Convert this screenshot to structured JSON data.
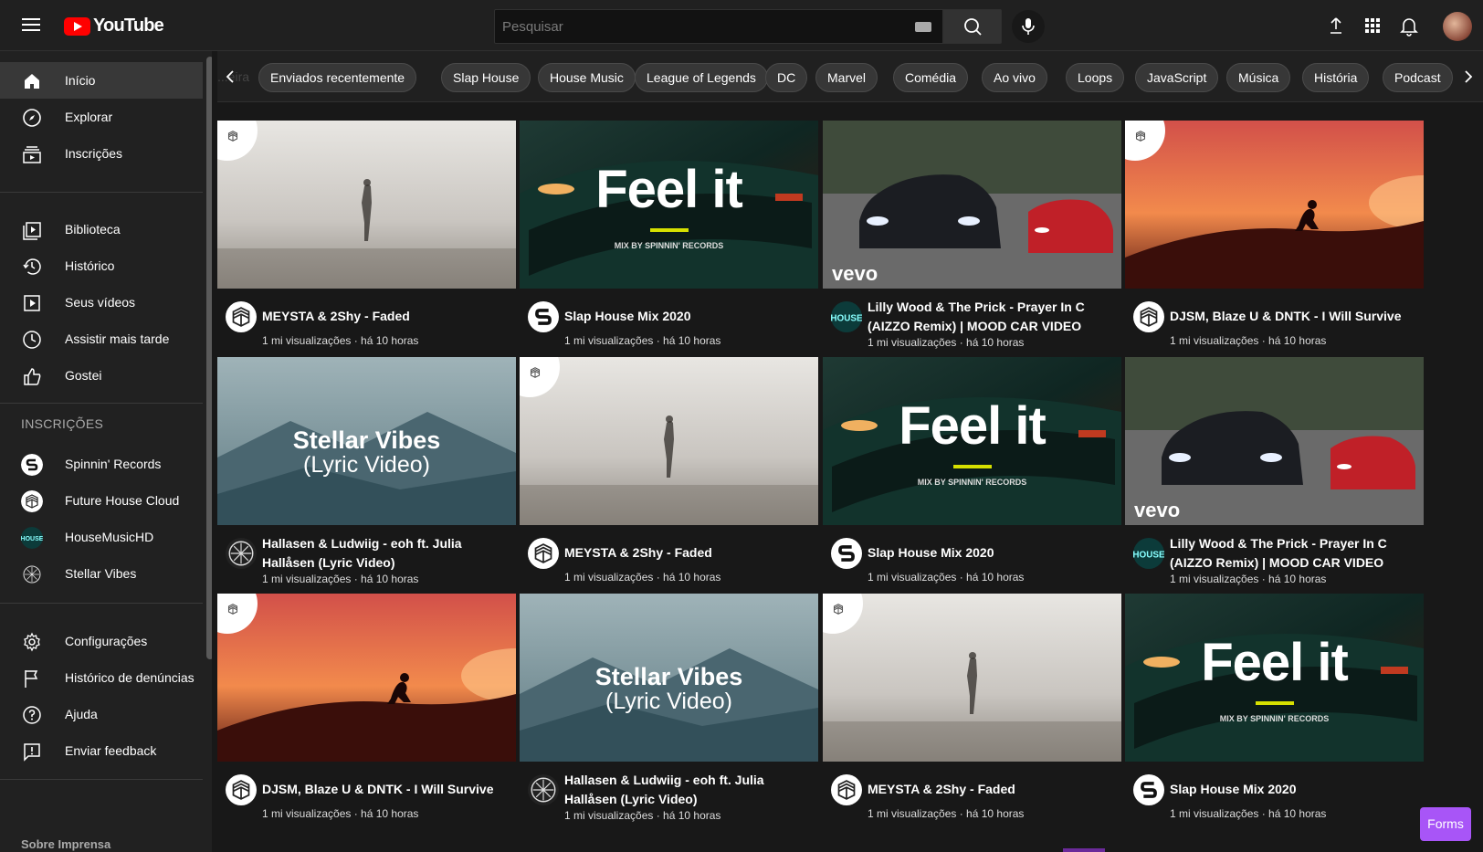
{
  "header": {
    "logo_text": "YouTube",
    "search_placeholder": "Pesquisar",
    "icons": [
      "menu-icon",
      "keyboard-icon",
      "search-icon",
      "mic-icon",
      "upload-icon",
      "apps-icon",
      "bell-icon"
    ]
  },
  "sidebar": {
    "main": [
      {
        "label": "Início",
        "icon": "home-icon",
        "active": true
      },
      {
        "label": "Explorar",
        "icon": "compass-icon"
      },
      {
        "label": "Inscrições",
        "icon": "subscriptions-icon"
      }
    ],
    "library": [
      {
        "label": "Biblioteca",
        "icon": "library-icon"
      },
      {
        "label": "Histórico",
        "icon": "history-icon"
      },
      {
        "label": "Seus vídeos",
        "icon": "play-icon"
      },
      {
        "label": "Assistir mais tarde",
        "icon": "clock-icon"
      },
      {
        "label": "Gostei",
        "icon": "thumbs-up-icon"
      }
    ],
    "subscriptions_heading": "INSCRIÇÕES",
    "subscriptions": [
      {
        "label": "Spinnin' Records"
      },
      {
        "label": "Future House Cloud"
      },
      {
        "label": "HouseMusicHD"
      },
      {
        "label": "Stellar Vibes"
      }
    ],
    "settings": [
      {
        "label": "Configurações",
        "icon": "gear-icon"
      },
      {
        "label": "Histórico de denúncias",
        "icon": "flag-icon"
      },
      {
        "label": "Ajuda",
        "icon": "help-icon"
      },
      {
        "label": "Enviar feedback",
        "icon": "feedback-icon"
      }
    ],
    "footer": "Sobre Imprensa"
  },
  "chips": {
    "faded_text": "...eira",
    "items": [
      "Enviados recentemente",
      "Slap House",
      "House Music",
      "League of Legends",
      "DC",
      "Marvel",
      "Comédia",
      "Ao vivo",
      "Loops",
      "JavaScript",
      "Música",
      "História",
      "Podcast"
    ]
  },
  "videos": [
    {
      "title": "MEYSTA & 2Shy - Faded",
      "meta": "1 mi visualizações · há 10 horas",
      "thumb": "fog",
      "channel": "fhc"
    },
    {
      "title": "Slap House Mix 2020",
      "meta": "1 mi visualizações · há 10 horas",
      "thumb": "feelit",
      "channel": "spinnin",
      "overlay_title": "Feel it",
      "overlay_sub": "MIX BY SPINNIN' RECORDS"
    },
    {
      "title": "Lilly Wood & The Prick - Prayer In C (AIZZO Remix) | MOOD CAR VIDEO",
      "meta": "1 mi visualizações · há 10 horas",
      "thumb": "cars",
      "channel": "house",
      "overlay_title": "vevo"
    },
    {
      "title": "DJSM, Blaze U & DNTK - I Will Survive",
      "meta": "1 mi visualizações · há 10 horas",
      "thumb": "sunset",
      "channel": "fhc"
    },
    {
      "title": "Hallasen & Ludwiig - eoh ft. Julia Hallåsen (Lyric Video)",
      "meta": "1 mi visualizações · há 10 horas",
      "thumb": "stellar",
      "channel": "stellar",
      "overlay_title": "Stellar Vibes",
      "overlay_sub": "(Lyric Video)"
    },
    {
      "title": "MEYSTA & 2Shy - Faded",
      "meta": "1 mi visualizações · há 10 horas",
      "thumb": "fog",
      "channel": "fhc"
    },
    {
      "title": "Slap House Mix 2020",
      "meta": "1 mi visualizações · há 10 horas",
      "thumb": "feelit",
      "channel": "spinnin",
      "overlay_title": "Feel it",
      "overlay_sub": "MIX BY SPINNIN' RECORDS"
    },
    {
      "title": "Lilly Wood & The Prick - Prayer In C (AIZZO Remix) | MOOD CAR VIDEO",
      "meta": "1 mi visualizações · há 10 horas",
      "thumb": "cars",
      "channel": "house",
      "overlay_title": "vevo"
    },
    {
      "title": "DJSM, Blaze U & DNTK - I Will Survive",
      "meta": "1 mi visualizações · há 10 horas",
      "thumb": "sunset",
      "channel": "fhc"
    },
    {
      "title": "Hallasen & Ludwiig - eoh ft. Julia Hallåsen (Lyric Video)",
      "meta": "1 mi visualizações · há 10 horas",
      "thumb": "stellar",
      "channel": "stellar",
      "overlay_title": "Stellar Vibes",
      "overlay_sub": "(Lyric Video)"
    },
    {
      "title": "MEYSTA & 2Shy - Faded",
      "meta": "1 mi visualizações · há 10 horas",
      "thumb": "fog",
      "channel": "fhc"
    },
    {
      "title": "Slap House Mix 2020",
      "meta": "1 mi visualizações · há 10 horas",
      "thumb": "feelit",
      "channel": "spinnin",
      "overlay_title": "Feel it",
      "overlay_sub": "MIX BY SPINNIN' RECORDS"
    }
  ],
  "forms_button": "Forms",
  "colors": {
    "brand_red": "#ff0000",
    "background": "#181818",
    "surface": "#202020",
    "forms_purple": "#a855f7"
  }
}
